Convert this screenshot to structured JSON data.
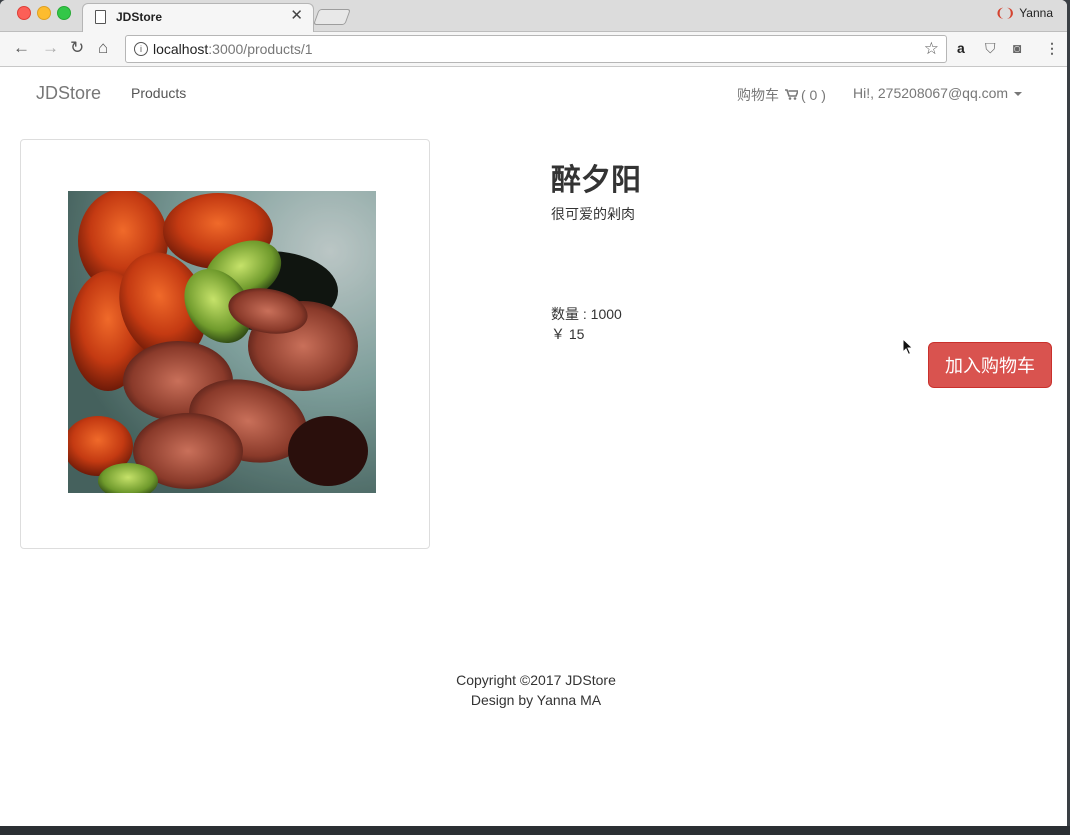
{
  "browser": {
    "tab_title": "JDStore",
    "profile_name": "Yanna",
    "url_host": "localhost",
    "url_rest": ":3000/products/1"
  },
  "navbar": {
    "brand": "JDStore",
    "products_label": "Products",
    "cart_label": "购物车",
    "cart_count": "( 0 )",
    "user_label": "Hi!, 275208067@qq.com"
  },
  "product": {
    "title": "醉夕阳",
    "description": "很可爱的剁肉",
    "quantity_text": "数量 : 1000",
    "price_text": "￥ 15",
    "add_to_cart_label": "加入购物车"
  },
  "footer": {
    "copyright": "Copyright ©2017 JDStore",
    "design": "Design by Yanna MA"
  },
  "colors": {
    "button_danger": "#d9534f",
    "nav_text": "#777777"
  }
}
